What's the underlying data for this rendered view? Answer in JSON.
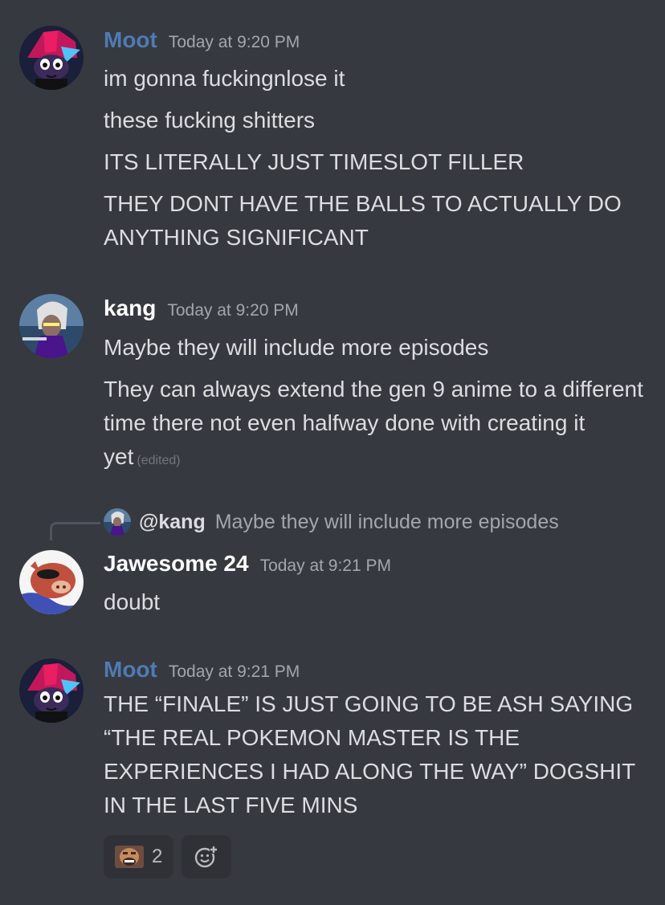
{
  "messages": [
    {
      "author": "Moot",
      "author_color": "#4e7bb3",
      "timestamp": "Today at 9:20 PM",
      "avatar": "moot-avatar",
      "lines": [
        "im gonna fuckingnlose it",
        "these fucking shitters",
        "ITS LITERALLY JUST TIMESLOT FILLER",
        "THEY DONT HAVE THE BALLS TO ACTUALLY DO ANYTHING SIGNIFICANT"
      ]
    },
    {
      "author": "kang",
      "author_color": "#ffffff",
      "timestamp": "Today at 9:20 PM",
      "avatar": "kang-avatar",
      "lines": [
        "Maybe they will include more episodes",
        "They can always extend the gen 9 anime to a different time there not even halfway done with creating it yet"
      ],
      "edited_label": "(edited)"
    },
    {
      "author": "Jawesome 24",
      "author_color": "#ffffff",
      "timestamp": "Today at 9:21 PM",
      "avatar": "jawesome-avatar",
      "reply": {
        "mention": "@kang",
        "text": "Maybe they will include more episodes"
      },
      "lines": [
        "doubt"
      ]
    },
    {
      "author": "Moot",
      "author_color": "#4e7bb3",
      "timestamp": "Today at 9:21 PM",
      "avatar": "moot-avatar",
      "lines": [
        "THE “FINALE” IS JUST GOING TO BE ASH SAYING “THE REAL POKEMON MASTER IS THE EXPERIENCES I HAD ALONG THE WAY” DOGSHIT IN THE LAST FIVE MINS"
      ],
      "reactions": [
        {
          "emoji": "laughing-man-emoji",
          "count": "2"
        }
      ],
      "add_reaction_icon": "add-reaction-icon"
    }
  ],
  "colors": {
    "background": "#36393f",
    "text": "#dcddde",
    "muted": "#a3a6aa",
    "reaction_bg": "#2f3136"
  }
}
